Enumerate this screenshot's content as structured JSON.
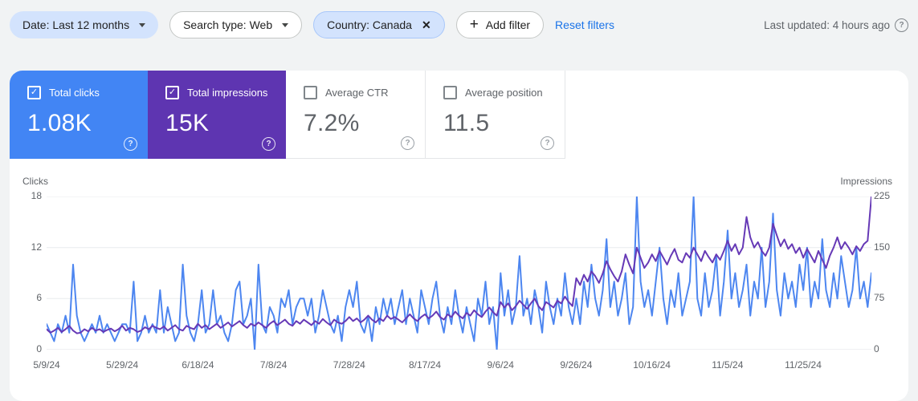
{
  "filters": {
    "date_chip": "Date: Last 12 months",
    "search_type_chip": "Search type: Web",
    "country_chip": "Country: Canada",
    "add_filter_label": "Add filter",
    "reset_filters_label": "Reset filters",
    "last_updated": "Last updated: 4 hours ago"
  },
  "icons": {
    "close": "✕",
    "plus": "+",
    "help": "?",
    "check": "✓"
  },
  "metrics": [
    {
      "label": "Total clicks",
      "value": "1.08K",
      "checked": true,
      "color": "#4285f4"
    },
    {
      "label": "Total impressions",
      "value": "15K",
      "checked": true,
      "color": "#5e35b1"
    },
    {
      "label": "Average CTR",
      "value": "7.2%",
      "checked": false,
      "color": "#ffffff"
    },
    {
      "label": "Average position",
      "value": "11.5",
      "checked": false,
      "color": "#ffffff"
    }
  ],
  "chart_data": {
    "type": "line",
    "grid": true,
    "left_axis": {
      "label": "Clicks",
      "ticks": [
        18,
        12,
        6,
        0
      ],
      "max": 18
    },
    "right_axis": {
      "label": "Impressions",
      "ticks": [
        225,
        150,
        75,
        0
      ],
      "max": 225
    },
    "x_tick_labels": [
      "5/9/24",
      "5/29/24",
      "6/18/24",
      "7/8/24",
      "7/28/24",
      "8/17/24",
      "9/6/24",
      "9/26/24",
      "10/16/24",
      "11/5/24",
      "11/25/24"
    ],
    "x_start_date": "5/9/24",
    "x_interval_days": 1,
    "series": [
      {
        "name": "Clicks",
        "axis": "left",
        "color": "#4d86f0",
        "values": [
          3,
          2,
          1,
          3,
          2,
          4,
          2,
          10,
          4,
          2,
          1,
          2,
          3,
          2,
          4,
          2,
          3,
          2,
          1,
          2,
          3,
          3,
          2,
          8,
          1,
          2,
          4,
          2,
          3,
          2,
          7,
          2,
          5,
          3,
          1,
          2,
          10,
          4,
          2,
          1,
          3,
          7,
          2,
          3,
          7,
          3,
          4,
          2,
          1,
          3,
          7,
          8,
          3,
          4,
          6,
          0,
          10,
          3,
          2,
          5,
          4,
          2,
          6,
          5,
          7,
          3,
          5,
          6,
          6,
          4,
          6,
          2,
          4,
          7,
          5,
          3,
          2,
          4,
          1,
          5,
          7,
          5,
          8,
          3,
          2,
          4,
          1,
          5,
          3,
          6,
          4,
          6,
          3,
          5,
          7,
          3,
          6,
          4,
          2,
          7,
          5,
          3,
          6,
          8,
          4,
          2,
          5,
          3,
          7,
          4,
          2,
          5,
          3,
          1,
          6,
          4,
          8,
          3,
          5,
          0,
          9,
          4,
          7,
          3,
          5,
          11,
          4,
          6,
          3,
          7,
          5,
          2,
          8,
          5,
          3,
          6,
          4,
          9,
          5,
          3,
          6,
          3,
          8,
          5,
          10,
          6,
          4,
          7,
          13,
          5,
          8,
          4,
          6,
          9,
          3,
          5,
          18,
          8,
          5,
          7,
          4,
          8,
          12,
          6,
          3,
          7,
          5,
          9,
          4,
          6,
          8,
          18,
          6,
          4,
          9,
          5,
          7,
          11,
          4,
          8,
          14,
          6,
          9,
          5,
          7,
          10,
          4,
          8,
          6,
          12,
          5,
          8,
          16,
          7,
          4,
          9,
          6,
          8,
          5,
          10,
          7,
          12,
          5,
          8,
          6,
          13,
          7,
          5,
          9,
          6,
          11,
          8,
          5,
          7,
          12,
          6,
          8,
          5,
          9
        ]
      },
      {
        "name": "Impressions",
        "axis": "right",
        "color": "#6639b6",
        "values": [
          30,
          25,
          28,
          32,
          26,
          30,
          35,
          28,
          24,
          25,
          30,
          27,
          32,
          28,
          30,
          26,
          29,
          31,
          27,
          30,
          35,
          28,
          32,
          30,
          26,
          28,
          33,
          30,
          35,
          32,
          30,
          34,
          28,
          32,
          36,
          30,
          28,
          35,
          32,
          30,
          38,
          32,
          36,
          30,
          34,
          38,
          32,
          36,
          40,
          34,
          38,
          42,
          36,
          32,
          38,
          35,
          40,
          36,
          32,
          38,
          42,
          36,
          40,
          44,
          38,
          35,
          42,
          38,
          44,
          40,
          36,
          42,
          38,
          45,
          40,
          36,
          44,
          40,
          38,
          42,
          48,
          42,
          46,
          40,
          44,
          50,
          44,
          40,
          46,
          42,
          50,
          45,
          48,
          44,
          40,
          46,
          52,
          46,
          42,
          48,
          52,
          46,
          50,
          56,
          48,
          44,
          52,
          48,
          56,
          50,
          46,
          54,
          50,
          58,
          52,
          48,
          56,
          62,
          55,
          50,
          70,
          62,
          68,
          58,
          64,
          72,
          66,
          60,
          68,
          75,
          64,
          58,
          70,
          66,
          62,
          72,
          68,
          78,
          70,
          64,
          105,
          95,
          110,
          100,
          115,
          108,
          98,
          112,
          130,
          118,
          108,
          100,
          115,
          140,
          125,
          112,
          150,
          135,
          120,
          128,
          140,
          130,
          145,
          135,
          125,
          138,
          148,
          132,
          128,
          142,
          135,
          150,
          140,
          130,
          145,
          136,
          128,
          140,
          132,
          145,
          160,
          145,
          155,
          140,
          150,
          195,
          165,
          150,
          158,
          145,
          138,
          150,
          185,
          168,
          152,
          162,
          148,
          155,
          142,
          150,
          135,
          148,
          138,
          128,
          145,
          132,
          120,
          138,
          150,
          165,
          148,
          158,
          150,
          140,
          152,
          145,
          155,
          160,
          225
        ]
      }
    ]
  }
}
